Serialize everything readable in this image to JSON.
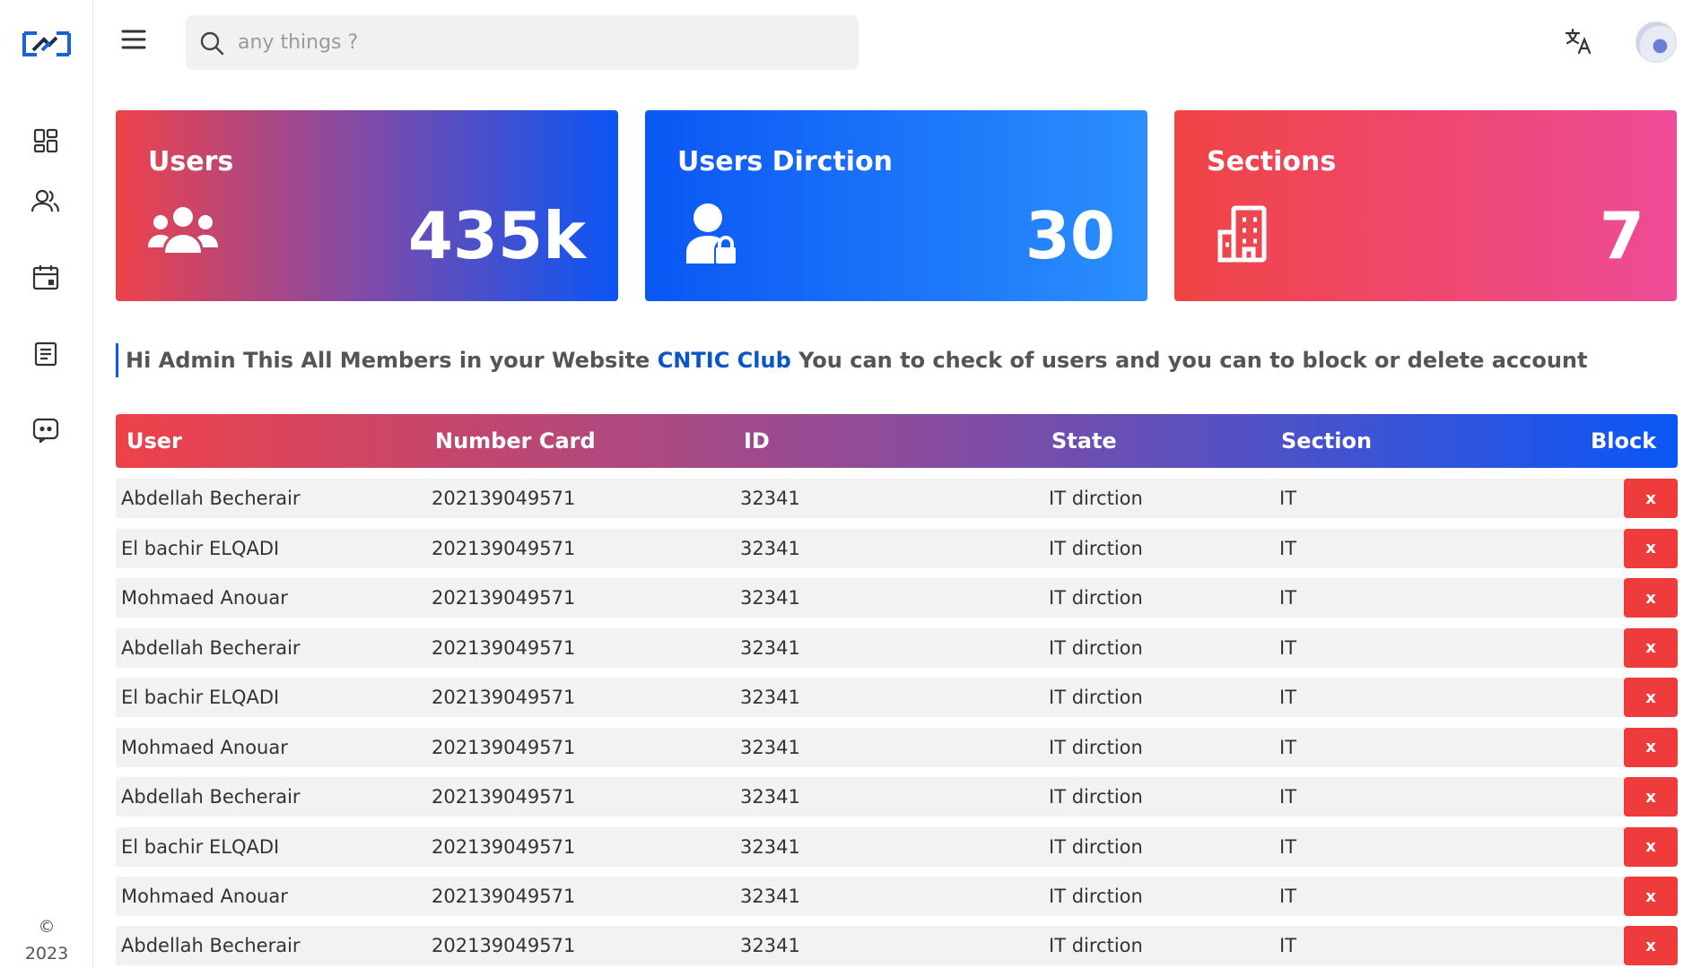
{
  "search": {
    "placeholder": "any things ?"
  },
  "footer": {
    "copyright_symbol": "©",
    "year": "2023"
  },
  "stats": [
    {
      "title": "Users",
      "value": "435k",
      "icon": "users-group-icon"
    },
    {
      "title": "Users Dirction",
      "value": "30",
      "icon": "user-lock-icon"
    },
    {
      "title": "Sections",
      "value": "7",
      "icon": "building-icon"
    }
  ],
  "intro": {
    "before": "Hi Admin This All Members in your Website ",
    "club": "CNTIC Club",
    "after": " You can to check of users and you can to block or delete account"
  },
  "table": {
    "headers": {
      "user": "User",
      "card": "Number Card",
      "id": "ID",
      "state": "State",
      "section": "Section",
      "block": "Block"
    },
    "block_label": "x",
    "rows": [
      {
        "user": "Abdellah Becherair",
        "card": "202139049571",
        "id": "32341",
        "state": "IT dirction",
        "section": "IT"
      },
      {
        "user": "El bachir ELQADI",
        "card": "202139049571",
        "id": "32341",
        "state": "IT dirction",
        "section": "IT"
      },
      {
        "user": "Mohmaed Anouar",
        "card": "202139049571",
        "id": "32341",
        "state": "IT dirction",
        "section": "IT"
      },
      {
        "user": "Abdellah Becherair",
        "card": "202139049571",
        "id": "32341",
        "state": "IT dirction",
        "section": "IT"
      },
      {
        "user": "El bachir ELQADI",
        "card": "202139049571",
        "id": "32341",
        "state": "IT dirction",
        "section": "IT"
      },
      {
        "user": "Mohmaed Anouar",
        "card": "202139049571",
        "id": "32341",
        "state": "IT dirction",
        "section": "IT"
      },
      {
        "user": "Abdellah Becherair",
        "card": "202139049571",
        "id": "32341",
        "state": "IT dirction",
        "section": "IT"
      },
      {
        "user": "El bachir ELQADI",
        "card": "202139049571",
        "id": "32341",
        "state": "IT dirction",
        "section": "IT"
      },
      {
        "user": "Mohmaed Anouar",
        "card": "202139049571",
        "id": "32341",
        "state": "IT dirction",
        "section": "IT"
      },
      {
        "user": "Abdellah Becherair",
        "card": "202139049571",
        "id": "32341",
        "state": "IT dirction",
        "section": "IT"
      }
    ]
  },
  "colors": {
    "accent_blue": "#0a55f5",
    "accent_red": "#ee4249",
    "pink": "#ee4b98",
    "block_button": "#ee3b3b"
  }
}
